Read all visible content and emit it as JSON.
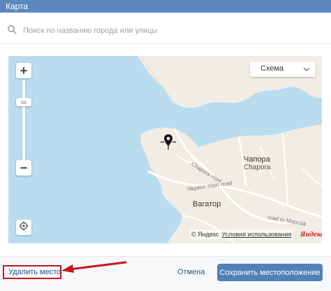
{
  "window": {
    "title": "Карта"
  },
  "search": {
    "placeholder": "Поиск по названию города или улицы",
    "value": ""
  },
  "map": {
    "layer_select": {
      "selected": "Схема"
    },
    "zoom": {
      "in_label": "+",
      "out_label": "−"
    },
    "labels": {
      "chapora_ru": "Чапора",
      "chapora_en": "Chapora",
      "vagator_ru": "Вагатор",
      "chapora_road": "Chapora road",
      "vagator_main_road": "Vagator main road",
      "road_to_mapusa": "road to Mapusa"
    },
    "attribution": {
      "copyright": "© Яндекс",
      "terms": "Условия использования",
      "logo": "Яндекс"
    },
    "colors": {
      "water": "#b9dcef",
      "land": "#f1ede4",
      "roads": "#ffffff"
    }
  },
  "footer": {
    "delete_label": "Удалить место",
    "cancel_label": "Отмена",
    "save_label": "Сохранить местоположение"
  },
  "colors": {
    "header": "#5b88bd",
    "accent": "#5181b8",
    "link": "#2a5885",
    "highlight": "#c6161d"
  }
}
